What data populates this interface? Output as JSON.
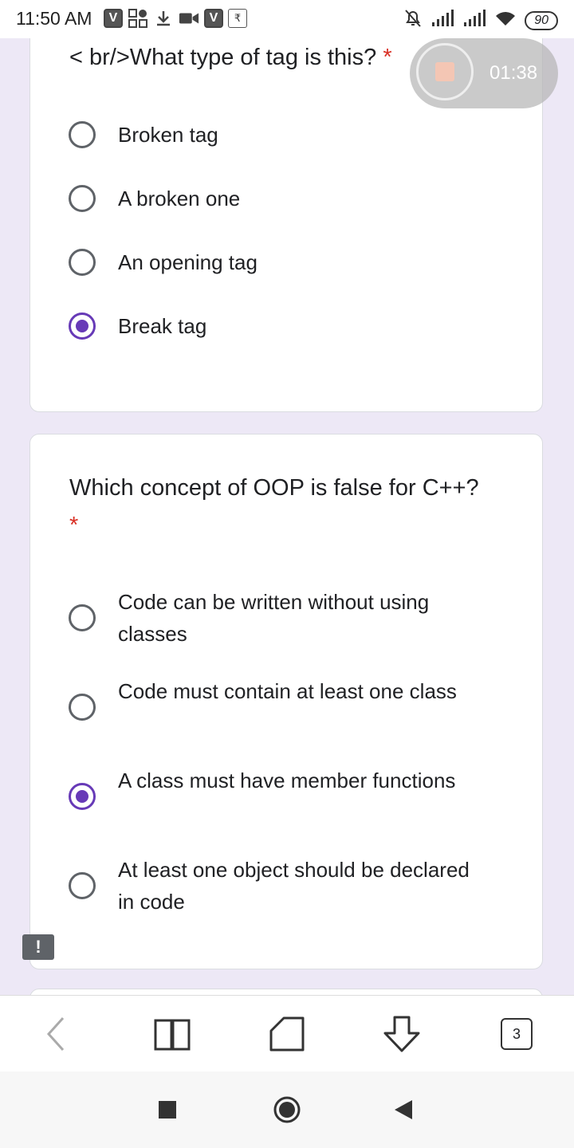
{
  "status_bar": {
    "time": "11:50 AM",
    "icons": [
      "v-app-icon",
      "apps-icon",
      "download-icon",
      "video-icon",
      "v-app-icon",
      "rupee-icon"
    ],
    "battery": "90"
  },
  "timer": {
    "time": "01:38"
  },
  "question1": {
    "text": "< br/>What type of tag is this?",
    "required_mark": "*",
    "options": [
      {
        "label": "Broken tag",
        "selected": false
      },
      {
        "label": "A broken one",
        "selected": false
      },
      {
        "label": "An opening tag",
        "selected": false
      },
      {
        "label": "Break tag",
        "selected": true
      }
    ]
  },
  "question2": {
    "text": "Which concept of OOP is false for C++?",
    "required_mark": "*",
    "options": [
      {
        "label": "Code can be written without using classes",
        "selected": false
      },
      {
        "label": "Code must contain at least one class",
        "selected": false
      },
      {
        "label": "A class must have member functions",
        "selected": true
      },
      {
        "label": "At least one object should be declared in code",
        "selected": false
      }
    ]
  },
  "feedback": {
    "label": "!"
  },
  "toolbar": {
    "tab_count": "3"
  },
  "colors": {
    "accent": "#673ab7",
    "background": "#ede8f6",
    "required": "#d93025"
  }
}
